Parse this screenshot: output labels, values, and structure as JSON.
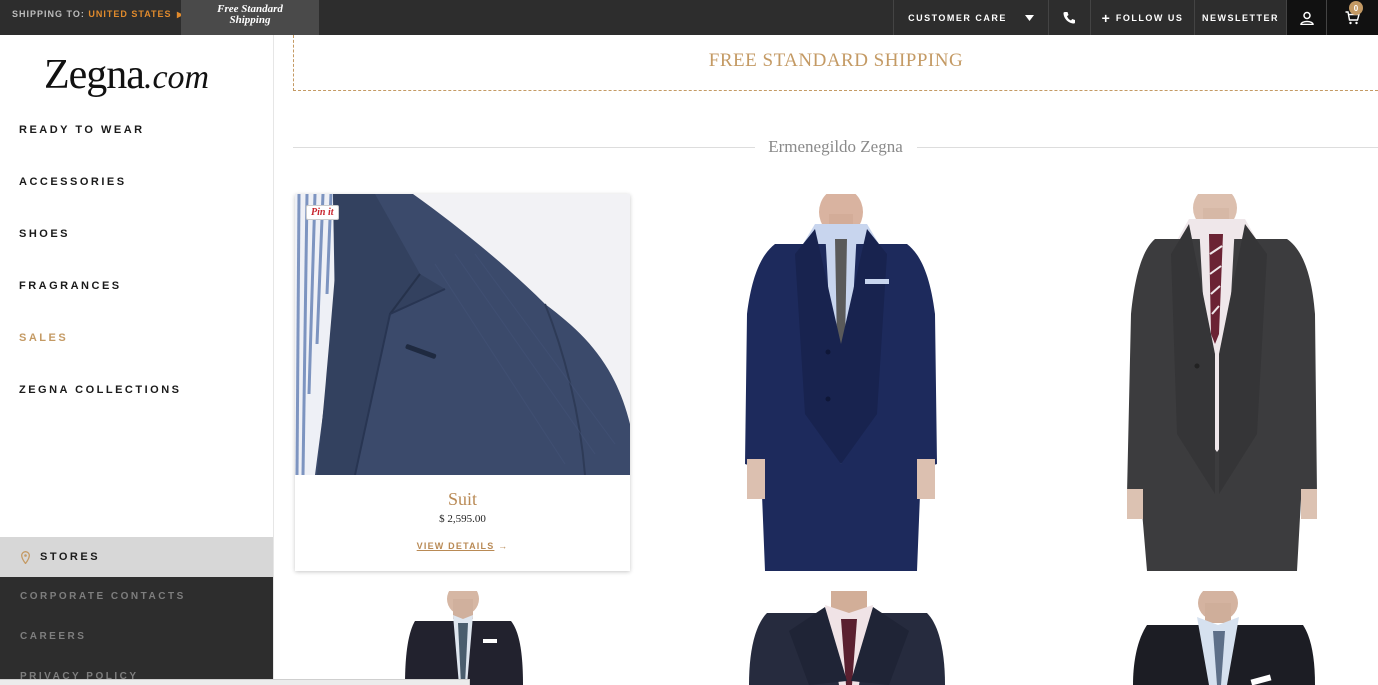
{
  "topbar": {
    "shipping_label": "SHIPPING TO:",
    "shipping_country": "UNITED STATES",
    "promo_line1": "Free Standard",
    "promo_line2": "Shipping",
    "customer_care": "CUSTOMER CARE",
    "follow_us": "FOLLOW US",
    "newsletter": "NEWSLETTER",
    "cart_count": "0"
  },
  "sidebar": {
    "logo_main": "Zegna",
    "logo_suffix": ".com",
    "nav": [
      "READY TO WEAR",
      "ACCESSORIES",
      "SHOES",
      "FRAGRANCES",
      "SALES",
      "ZEGNA COLLECTIONS"
    ],
    "stores": "STORES",
    "footer": [
      "CORPORATE CONTACTS",
      "CAREERS",
      "PRIVACY POLICY"
    ]
  },
  "main": {
    "banner": "FREE STANDARD SHIPPING",
    "brand": "Ermenegildo Zegna",
    "featured": {
      "pin_label": "Pin it",
      "name": "Suit",
      "price": "$ 2,595.00",
      "link": "VIEW DETAILS",
      "link_arrow": "→"
    }
  },
  "colors": {
    "accent": "#c49a64",
    "topbar": "#2d2d2d",
    "stores_bg": "#d7d7d7"
  }
}
